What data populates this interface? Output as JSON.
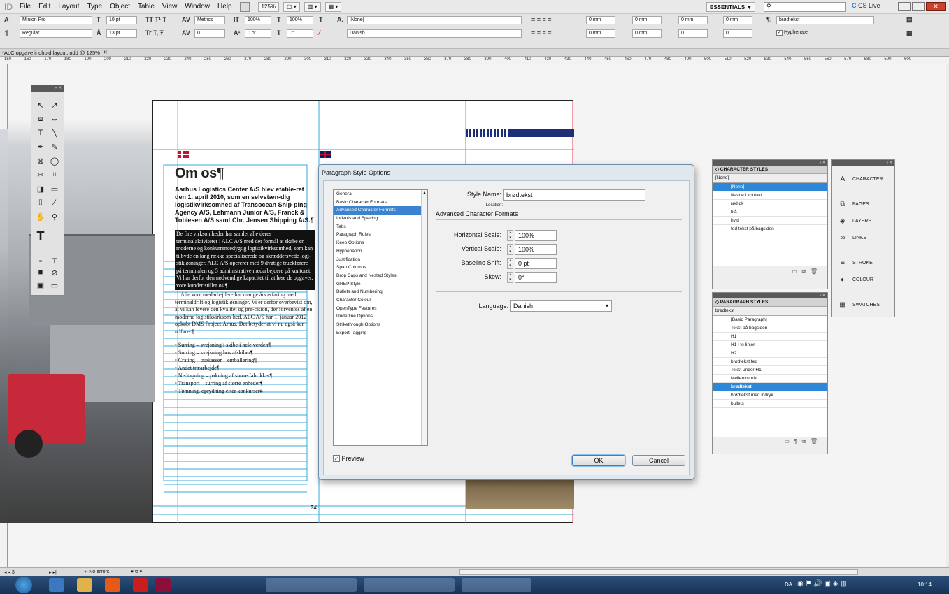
{
  "menubar": {
    "app_logo": "ID",
    "items": [
      "File",
      "Edit",
      "Layout",
      "Type",
      "Object",
      "Table",
      "View",
      "Window",
      "Help"
    ],
    "zoom": "125%",
    "workspace": "ESSENTIALS ▼",
    "cs_live": "CS Live"
  },
  "controlbar": {
    "font_family": "Minion Pro",
    "font_style": "Regular",
    "font_size": "10 pt",
    "leading": "13 pt",
    "kerning": "Metrics",
    "tracking": "0",
    "horiz_scale": "100%",
    "vert_scale": "100%",
    "baseline": "0 pt",
    "skew": "0°",
    "char_style": "[None]",
    "language": "Danish",
    "indent_values": [
      "0 mm",
      "0 mm",
      "0 mm",
      "0 mm",
      "0 mm",
      "0 mm",
      "0",
      "0"
    ],
    "para_style": "brødtekst",
    "hyphenate": "Hyphenate"
  },
  "doc": {
    "tab_title": "*ALC opgave indhold layout.indd @ 125%",
    "ruler_ticks": [
      "150",
      "160",
      "170",
      "180",
      "190",
      "200",
      "210",
      "220",
      "230",
      "240",
      "250",
      "260",
      "270",
      "280",
      "290",
      "300",
      "310",
      "320",
      "330",
      "340",
      "350",
      "360",
      "370",
      "380",
      "390",
      "400",
      "410",
      "420",
      "430",
      "440",
      "450",
      "460",
      "470",
      "480",
      "490",
      "500",
      "510",
      "520",
      "530",
      "540",
      "550",
      "560",
      "570",
      "580",
      "590",
      "600"
    ]
  },
  "page_content": {
    "heading": "Om os¶",
    "lead": "Aarhus Logistics Center A/S blev etable-ret den 1. april 2010, som en selvstæn-dig logistikvirksomhed af Transocean Ship-ping Agency A/S, Lehmann Junior A/S, Franck & Tobiesen A/S samt Chr. Jensen Shipping A/S.¶",
    "body_highlight": "De fire virksomheder har samlet alle deres terminalaktiviteter i ALC A/S med det formål at skabe en moderne og konkurrencedygtig logistikvirksomhed, som kan tilbyde en lang række specialiserede og skræddersyede logi-stikløsninger. ALC A/S opererer med 9 dygtige truckførere på terminalen og 5 administrative medarbejdere på kontoret. Vi har derfor den nødvendige kapacitet til at løse de opgaver, vore kunder stiller os.¶",
    "body": "Alle vore medarbejdere har mange års erfaring med terminaldrift og logistikløsninger. Vi er derfor overbevist om, at vi kan levere den kvalitet og pre-cision, der forventes af en moderne logistikvirksom-hed. ALC A/S har 1. januar 2012 opkøbt DMS Project Århus. Det betyder at vi nu også kan udfører¶",
    "bullets": [
      "Surring – svejsning i skibe i hele verden¶",
      "Surring – svejsning hos afskiber¶",
      "Crating – trækasser – emballering¶",
      "Andet træarbejde¶",
      "Nedtagning – pakning af større fabrikker¶",
      "Transport – surring af større enheder¶",
      "Tømning, oprydning efter konkurser#"
    ],
    "page_number": "3#"
  },
  "dialog": {
    "title": "Paragraph Style Options",
    "style_name_label": "Style Name:",
    "style_name": "brødtekst",
    "location_label": "Location:",
    "section_title": "Advanced Character Formats",
    "categories": [
      "General",
      "Basic Character Formats",
      "Advanced Character Formats",
      "Indents and Spacing",
      "Tabs",
      "Paragraph Rules",
      "Keep Options",
      "Hyphenation",
      "Justification",
      "Span Columns",
      "Drop Caps and Nested Styles",
      "GREP Style",
      "Bullets and Numbering",
      "Character Colour",
      "OpenType Features",
      "Underline Options",
      "Strikethrough Options",
      "Export Tagging"
    ],
    "selected_category": 2,
    "horizontal_scale_label": "Horizontal Scale:",
    "horizontal_scale": "100%",
    "vertical_scale_label": "Vertical Scale:",
    "vertical_scale": "100%",
    "baseline_shift_label": "Baseline Shift:",
    "baseline_shift": "0 pt",
    "skew_label": "Skew:",
    "skew": "0°",
    "language_label": "Language:",
    "language": "Danish",
    "preview_label": "Preview",
    "ok_label": "OK",
    "cancel_label": "Cancel"
  },
  "character_styles": {
    "title": "◇ CHARACTER STYLES",
    "current": "[None]",
    "items": [
      "[None]",
      "Navne i kontakt",
      "rød dk",
      "blå",
      "hvid",
      "fed tekst på bagsiden"
    ],
    "selected": 0
  },
  "paragraph_styles": {
    "title": "◇ PARAGRAPH STYLES",
    "current": "brødtekst",
    "items": [
      "[Basic Paragraph]",
      "Tekst på bagsiden",
      "H1",
      "H1 i to linjer",
      "H2",
      "brødtekst fed",
      "Tekst under H1",
      "Mellemrubrik",
      "brødtekst",
      "brødtekst med indryk",
      "bullets"
    ],
    "selected": 8
  },
  "dock": {
    "items": [
      {
        "label": "CHARACTER",
        "icon": "A"
      },
      {
        "label": "PAGES",
        "icon": "⧉"
      },
      {
        "label": "LAYERS",
        "icon": "◈"
      },
      {
        "label": "LINKS",
        "icon": "∞"
      },
      {
        "label": "STROKE",
        "icon": "≡"
      },
      {
        "label": "COLOUR",
        "icon": "◐"
      },
      {
        "label": "SWATCHES",
        "icon": "▦"
      }
    ]
  },
  "statusbar": {
    "page": "3",
    "errors": "No errors"
  },
  "taskbar": {
    "lang": "DA",
    "time": "10:14"
  },
  "colors": {
    "selection": "#3b83d1",
    "guides": "#3aa8d8",
    "margin": "#e0405a",
    "navy": "#1e2f78"
  }
}
